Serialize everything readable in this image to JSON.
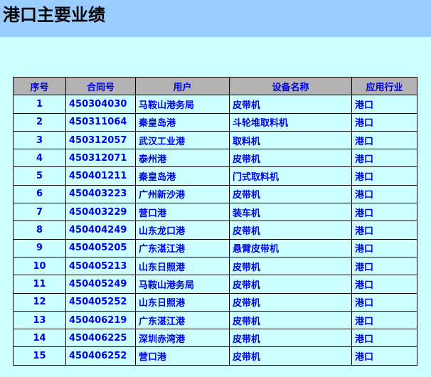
{
  "page": {
    "title": "港口主要业绩"
  },
  "table": {
    "headers": [
      "序号",
      "合同号",
      "用户",
      "设备名称",
      "应用行业"
    ],
    "rows": [
      [
        "1",
        "450304030",
        "马鞍山港务局",
        "皮带机",
        "港口"
      ],
      [
        "2",
        "450311064",
        "秦皇岛港",
        "斗轮堆取料机",
        "港口"
      ],
      [
        "3",
        "450312057",
        "武汉工业港",
        "取料机",
        "港口"
      ],
      [
        "4",
        "450312071",
        "泰州港",
        "皮带机",
        "港口"
      ],
      [
        "5",
        "450401211",
        "秦皇岛港",
        "门式取料机",
        "港口"
      ],
      [
        "6",
        "450403223",
        "广州新沙港",
        "皮带机",
        "港口"
      ],
      [
        "7",
        "450403229",
        "营口港",
        "装车机",
        "港口"
      ],
      [
        "8",
        "450404249",
        "山东龙口港",
        "皮带机",
        "港口"
      ],
      [
        "9",
        "450405205",
        "广东湛江港",
        "悬臂皮带机",
        "港口"
      ],
      [
        "10",
        "450405213",
        "山东日照港",
        "皮带机",
        "港口"
      ],
      [
        "11",
        "450405249",
        "马鞍山港务局",
        "皮带机",
        "港口"
      ],
      [
        "12",
        "450405252",
        "山东日照港",
        "皮带机",
        "港口"
      ],
      [
        "13",
        "450406219",
        "广东湛江港",
        "皮带机",
        "港口"
      ],
      [
        "14",
        "450406225",
        "深圳赤湾港",
        "皮带机",
        "港口"
      ],
      [
        "15",
        "450406252",
        "营口港",
        "皮带机",
        "港口"
      ]
    ]
  },
  "colors": {
    "page_background": "#ccffff",
    "title_bar": "#99ccff",
    "header_background": "#b3b3b3",
    "text": "#0000ee"
  }
}
